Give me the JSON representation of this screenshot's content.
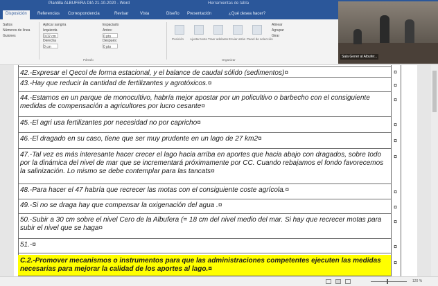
{
  "window": {
    "title": "Plantilla ALBUFERA DIA 21-10-2020 - Word",
    "contextual": "Herramientas de tabla"
  },
  "tabs": [
    "Disposición",
    "Referencias",
    "Correspondencia",
    "Revisar",
    "Vista",
    "Diseño",
    "Presentación",
    "¿Qué desea hacer?"
  ],
  "toolbar": {
    "saltos": "Saltos",
    "numeros_linea": "Números de línea",
    "guiones": "Guiones",
    "aplicar_sangria": "Aplicar sangría",
    "izquierda": "Izquierda",
    "izquierda_val": "0,02 cm",
    "derecha": "Derecha",
    "derecha_val": "0 cm",
    "espaciado": "Espaciado",
    "antes": "Antes:",
    "antes_val": "0 pto",
    "despues": "Después:",
    "despues_val": "0 pto",
    "parrafo_group": "Párrafo",
    "posicion": "Posición",
    "ajustar_texto": "Ajustar texto",
    "traer_adelante": "Traer adelante",
    "enviar_atras": "Enviar atrás",
    "panel_seleccion": "Panel de selección",
    "alinear": "Alinear",
    "agrupar": "Agrupar",
    "girar": "Girar",
    "organizar_group": "Organizar"
  },
  "video": {
    "caption": "Sala Gener al Albufer..."
  },
  "rows": [
    "42.-Expresar el Qecol de forma estacional, y el balance de caudal sólido (sedimentos)¤",
    "43.-Hay que reducir la cantidad de fertilizantes y agrotóxicos.¤",
    "44.-Estamos en un parque de monocultivo, habría mejor apostar por un policultivo o barbecho con el consiguiente medidas de compensación a agricultores por lucro cesante¤",
    "45.-El agri usa fertilizantes por necesidad no por capricho¤",
    "46.-El dragado en su caso, tiene que ser muy prudente en un lago de 27 km2¤",
    "47.-Tal vez es más interesante hacer crecer el lago hacia arriba en aportes que hacia abajo con dragados, sobre todo por la dinámica del nivel de mar que se incrementará próximamente por CC. Cuando rebajamos el fondo favorecemos la salinización. Lo mismo se debe contemplar para las tancats¤",
    "48.-Para hacer el 47 habría que recrecer las motas con el consiguiente coste agrícola.¤",
    "49.-Si no se draga hay que compensar la oxigenación del agua .¤",
    "50.-Subir a 30 cm sobre el nivel Cero de la Albufera (= 18 cm del nivel medio del mar. Si hay que recrecer motas para subir el nivel que se haga¤",
    "51.-¤",
    "C.2.-Promover mecanismos o instrumentos para que las administraciones competentes ejecuten las medidas necesarias para mejorar la calidad de los aportes al lago.¤"
  ],
  "cellmark": "¤",
  "status": {
    "zoom": "120 %"
  }
}
